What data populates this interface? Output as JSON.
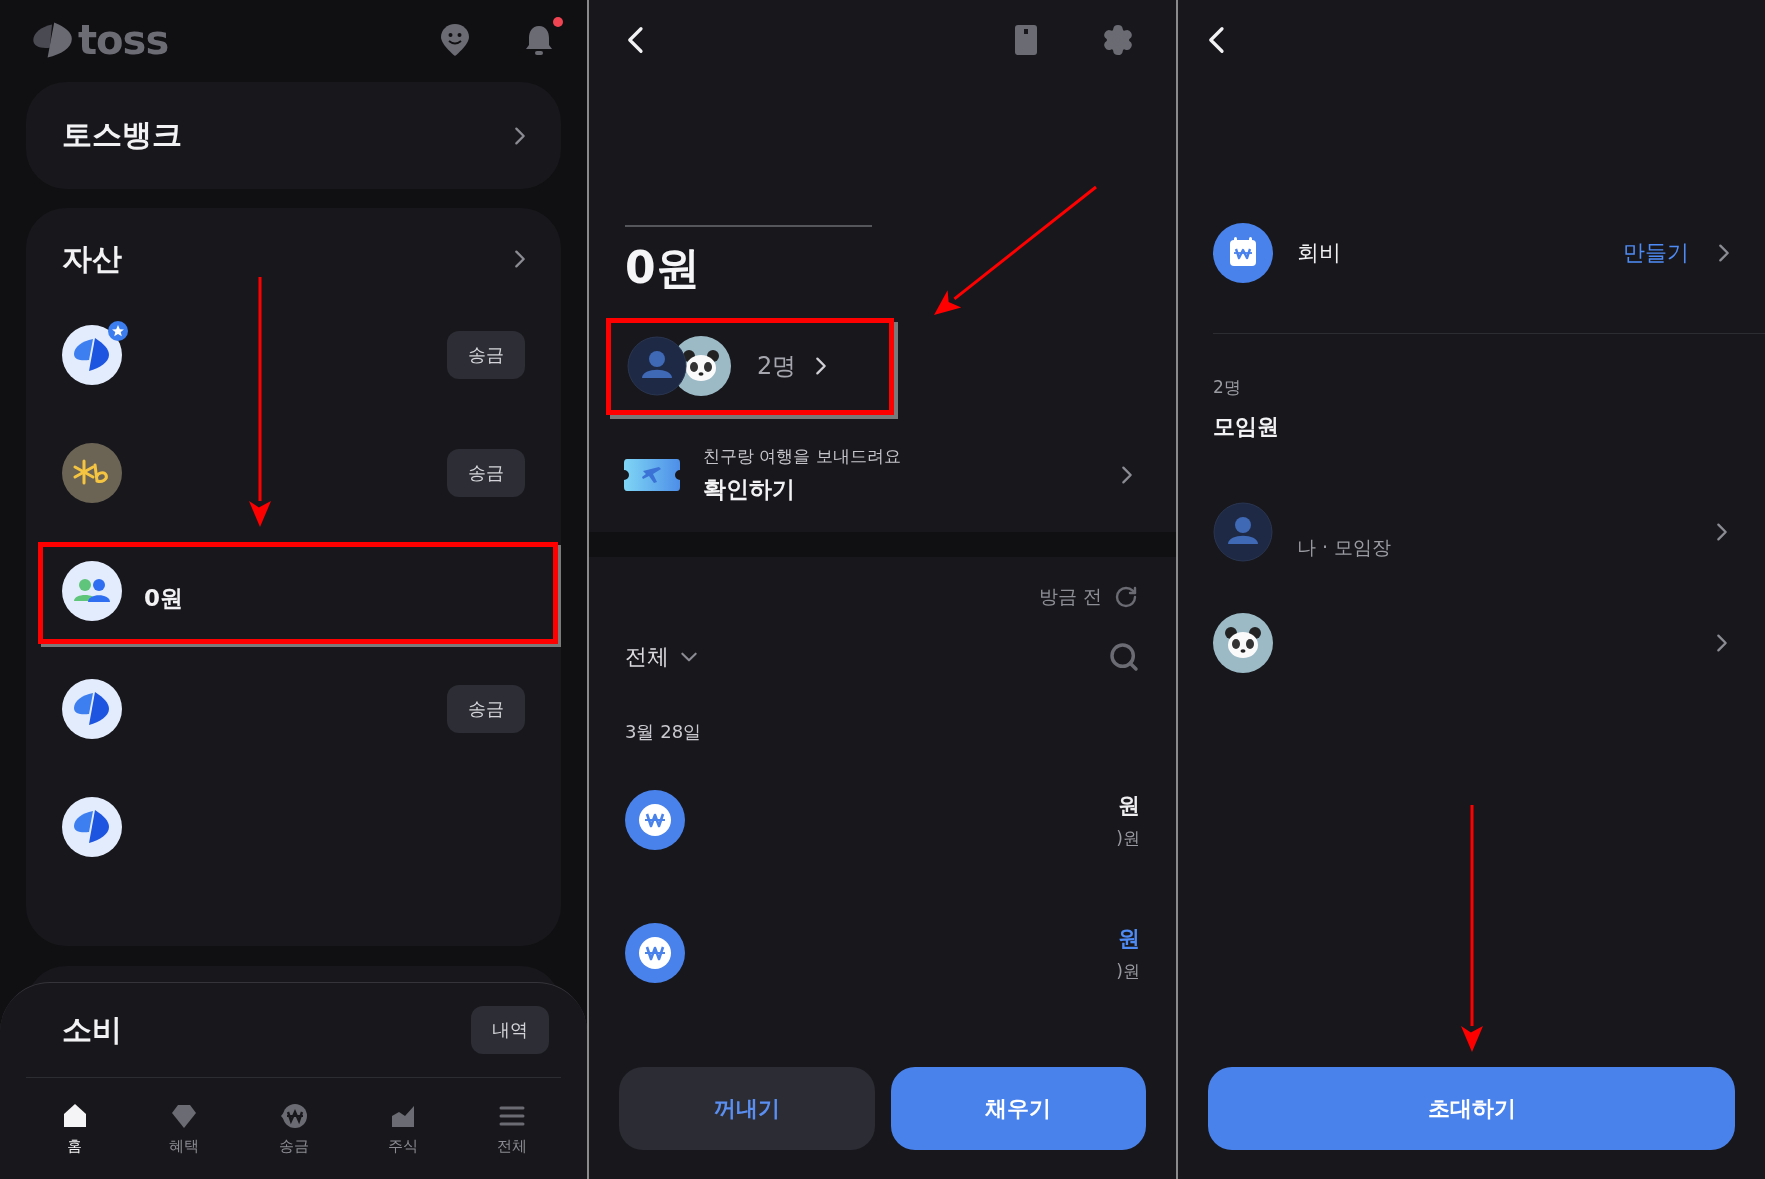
{
  "home_screen": {
    "logo": "toss",
    "has_notification": true,
    "bank_card": {
      "title": "토스뱅크"
    },
    "assets": {
      "title": "자산",
      "items": [
        {
          "kind": "toss",
          "starred": true,
          "button": "송금",
          "highlighted": false
        },
        {
          "kind": "kb",
          "starred": false,
          "button": "송금",
          "highlighted": false
        },
        {
          "kind": "group",
          "starred": false,
          "amount": "0원",
          "highlighted": true
        },
        {
          "kind": "toss",
          "starred": false,
          "button": "송금",
          "highlighted": false
        },
        {
          "kind": "toss",
          "starred": false,
          "highlighted": false
        }
      ]
    },
    "spending": {
      "title": "소비",
      "button": "내역"
    },
    "nav": [
      {
        "kind": "home",
        "label": "홈",
        "selected": true
      },
      {
        "kind": "benefits",
        "label": "혜택",
        "selected": false
      },
      {
        "kind": "transfer",
        "label": "송금",
        "selected": false
      },
      {
        "kind": "stocks",
        "label": "주식",
        "selected": false
      },
      {
        "kind": "menu",
        "label": "전체",
        "selected": false
      }
    ]
  },
  "account_screen": {
    "balance": "0원",
    "members": {
      "count": "2명",
      "highlighted": true,
      "avatars": [
        {
          "kind": "person"
        },
        {
          "kind": "panda"
        }
      ]
    },
    "promo": {
      "caption": "친구랑 여행을 보내드려요",
      "action": "확인하기"
    },
    "updated": "방금 전",
    "filter": "전체",
    "date": "3월 28일",
    "transactions": [
      {
        "amount": "원",
        "color": "#eeeef0",
        "balance": ")원"
      },
      {
        "amount": "원",
        "color": "#4f8bf5",
        "balance": ")원"
      }
    ],
    "buttons": [
      {
        "kind": "secondary",
        "label": "꺼내기"
      },
      {
        "kind": "primary",
        "label": "채우기"
      }
    ]
  },
  "members_screen": {
    "fee": {
      "label": "회비",
      "action": "만들기"
    },
    "count": "2명",
    "title": "모임원",
    "members": [
      {
        "kind": "person",
        "role": "나 · 모임장"
      },
      {
        "kind": "panda"
      }
    ],
    "button": "초대하기"
  }
}
